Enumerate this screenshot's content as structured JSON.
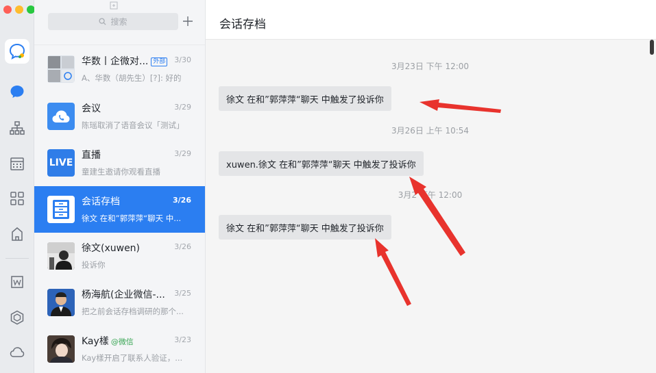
{
  "search": {
    "placeholder": "搜索"
  },
  "conversations": [
    {
      "title": "华数丨企微对...",
      "tag": "外部",
      "subtitle": "A、华数（胡先生）[?]: 好的",
      "date": "3/30"
    },
    {
      "title": "会议",
      "subtitle": "陈瑶取消了语音会议「测试」",
      "date": "3/29"
    },
    {
      "title": "直播",
      "subtitle": "童建生邀请你观看直播",
      "date": "3/29",
      "avatar_text": "LIVE"
    },
    {
      "title": "会话存档",
      "subtitle": "徐文 在和”郭萍萍“聊天 中...",
      "date": "3/26",
      "active": true
    },
    {
      "title": "徐文(xuwen)",
      "subtitle": "投诉你",
      "date": "3/26"
    },
    {
      "title": "杨海航(企业微信-...",
      "subtitle": "把之前会话存档调研的那个...",
      "date": "3/25"
    },
    {
      "title": "Kay樣",
      "tag": "@微信",
      "subtitle": "Kay樣开启了联系人验证，...",
      "date": "3/23"
    }
  ],
  "chat": {
    "title": "会话存档",
    "messages": [
      {
        "time": "3月23日 下午 12:00",
        "text": "徐文 在和”郭萍萍“聊天 中触发了投诉你"
      },
      {
        "time": "3月26日 上午 10:54",
        "text": "xuwen.徐文 在和”郭萍萍“聊天 中触发了投诉你"
      },
      {
        "time": "3月2  下午 12:00",
        "text": "徐文 在和”郭萍萍“聊天 中触发了投诉你"
      }
    ]
  },
  "colors": {
    "accent": "#2b7ef1",
    "arrow": "#e8332d",
    "traffic_close": "#fe5f57",
    "traffic_min": "#febc2e",
    "traffic_max": "#28c840"
  }
}
